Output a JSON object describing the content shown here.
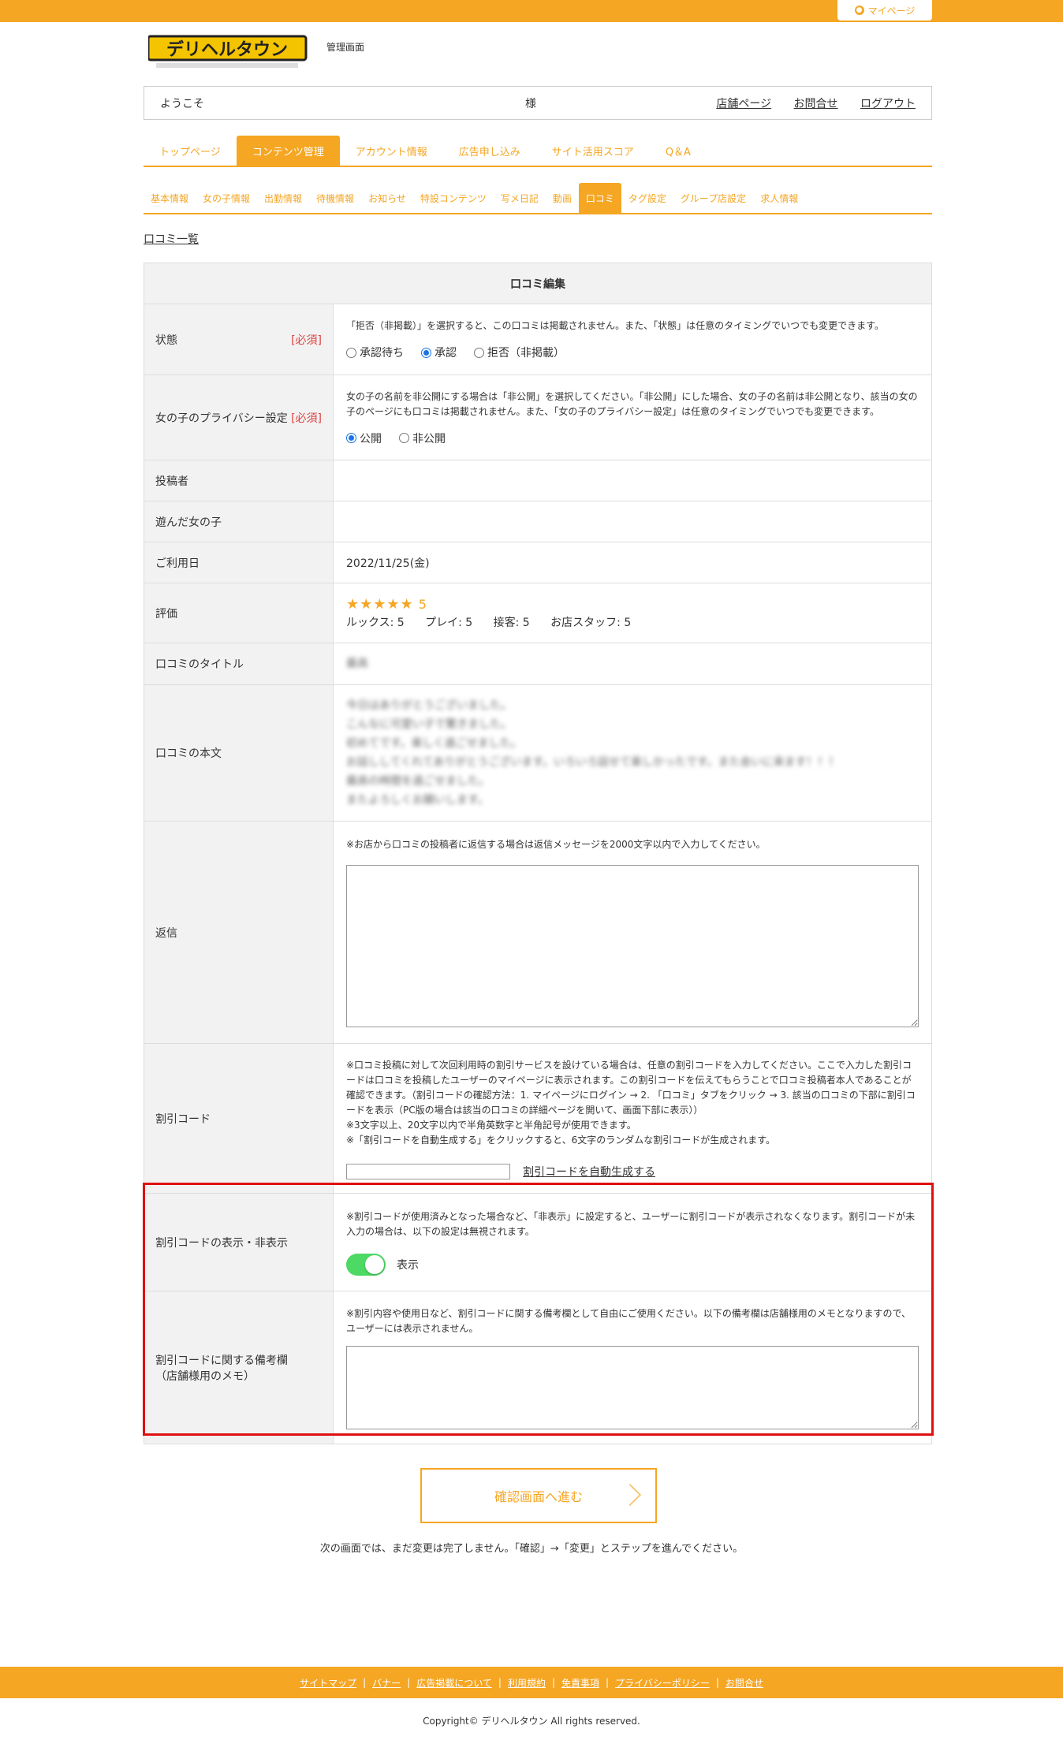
{
  "header": {
    "mypage_label": "マイページ",
    "logo_text": "デリヘルタウン",
    "admin_label": "管理画面"
  },
  "welcome": {
    "greeting": "ようこそ",
    "sama": "様",
    "links": [
      "店舗ページ",
      "お問合せ",
      "ログアウト"
    ]
  },
  "nav1": [
    "トップページ",
    "コンテンツ管理",
    "アカウント情報",
    "広告申し込み",
    "サイト活用スコア",
    "Q＆A"
  ],
  "nav2": [
    "基本情報",
    "女の子情報",
    "出勤情報",
    "待機情報",
    "お知らせ",
    "特設コンテンツ",
    "写メ日記",
    "動画",
    "口コミ",
    "タグ設定",
    "グループ店設定",
    "求人情報"
  ],
  "breadcrumb": "口コミ一覧",
  "form": {
    "title": "口コミ編集",
    "required": "[必須]",
    "status": {
      "label": "状態",
      "note": "「拒否（非掲載）」を選択すると、この口コミは掲載されません。また、「状態」は任意のタイミングでいつでも変更できます。",
      "options": [
        "承認待ち",
        "承認",
        "拒否（非掲載）"
      ],
      "selected": "承認"
    },
    "privacy": {
      "label": "女の子のプライバシー設定",
      "note": "女の子の名前を非公開にする場合は「非公開」を選択してください。「非公開」にした場合、女の子の名前は非公開となり、該当の女の子のページにも口コミは掲載されません。また、「女の子のプライバシー設定」は任意のタイミングでいつでも変更できます。",
      "options": [
        "公開",
        "非公開"
      ],
      "selected": "公開"
    },
    "poster": {
      "label": "投稿者",
      "value": ""
    },
    "girl": {
      "label": "遊んだ女の子",
      "value": ""
    },
    "date": {
      "label": "ご利用日",
      "value": "2022/11/25(金)"
    },
    "rating": {
      "label": "評価",
      "stars": 5,
      "score": "5",
      "looks": "ルックス: 5",
      "play": "プレイ: 5",
      "service": "接客: 5",
      "staff": "お店スタッフ: 5"
    },
    "review_title": {
      "label": "口コミのタイトル",
      "value": "最高"
    },
    "review_body": {
      "label": "口コミの本文",
      "lines": [
        "今日はありがとうございました。",
        "こんなに可愛い子で驚きました。",
        "初めてです。楽しく過ごせました。",
        "お話ししてくれてありがとうございます。いろいろ話せて楽しかったです。また会いに来ます！！！",
        "最高の時間を過ごせました。",
        "またよろしくお願いします。"
      ]
    },
    "reply": {
      "label": "返信",
      "note": "※お店から口コミの投稿者に返信する場合は返信メッセージを2000文字以内で入力してください。"
    },
    "discount": {
      "label": "割引コード",
      "note1": "※口コミ投稿に対して次回利用時の割引サービスを設けている場合は、任意の割引コードを入力してください。ここで入力した割引コードは口コミを投稿したユーザーのマイページに表示されます。この割引コードを伝えてもらうことで口コミ投稿者本人であることが確認できます。（割引コードの確認方法：1. マイページにログイン → 2. 「口コミ」タブをクリック → 3. 該当の口コミの下部に割引コードを表示（PC版の場合は該当の口コミの詳細ページを開いて、画面下部に表示））",
      "note2": "※3文字以上、20文字以内で半角英数字と半角記号が使用できます。",
      "note3": "※「割引コードを自動生成する」をクリックすると、6文字のランダムな割引コードが生成されます。",
      "generate_label": "割引コードを自動生成する"
    },
    "display": {
      "label": "割引コードの表示・非表示",
      "note": "※割引コードが使用済みとなった場合など、「非表示」に設定すると、ユーザーに割引コードが表示されなくなります。割引コードが未入力の場合は、以下の設定は無視されます。",
      "toggle_label": "表示",
      "toggle_on": true
    },
    "memo": {
      "label1": "割引コードに関する備考欄",
      "label2": "（店舗様用のメモ）",
      "note": "※割引内容や使用日など、割引コードに関する備考欄として自由にご使用ください。以下の備考欄は店舗様用のメモとなりますので、ユーザーには表示されません。"
    }
  },
  "confirm": {
    "button_label": "確認画面へ進む",
    "note": "次の画面では、まだ変更は完了しません。「確認」→「変更」とステップを進んでください。"
  },
  "footer": {
    "links": [
      "サイトマップ",
      "バナー",
      "広告掲載について",
      "利用規約",
      "免責事項",
      "プライバシーポリシー",
      "お問合せ"
    ],
    "copyright": "Copyright© デリヘルタウン All rights reserved."
  },
  "colors": {
    "accent": "#f5a623",
    "highlight": "#e01010",
    "required": "#e04040",
    "toggle": "#4cd964"
  }
}
